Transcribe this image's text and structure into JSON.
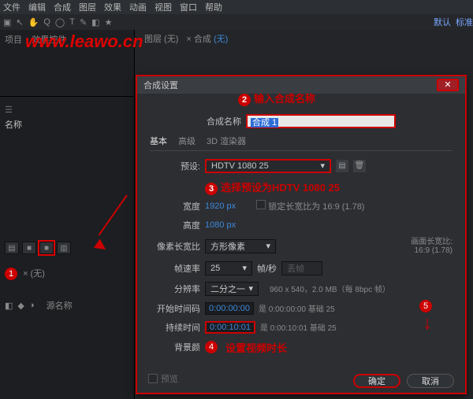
{
  "menubar": [
    "文件",
    "编辑",
    "合成",
    "图层",
    "效果",
    "动画",
    "视图",
    "窗口",
    "帮助"
  ],
  "toolrow": {
    "workspace_default": "默认",
    "workspace_std": "标准"
  },
  "watermark": "www.leawo.cn",
  "preview": {
    "tab1": "图层  (无)",
    "tab2_prefix": "×  合成",
    "tab2_none": "(无)"
  },
  "left": {
    "proj_tab": "项目",
    "fx_tab": "效果控件",
    "name_col": "名称",
    "tl_tab1": "×  (无)",
    "src_col": "源名称",
    "icons": [
      "▤",
      "■",
      "■",
      "▥"
    ]
  },
  "dialog": {
    "title": "合成设置",
    "name_label": "合成名称",
    "name_value": "合成 1",
    "tabs": [
      "基本",
      "高级",
      "3D 渲染器"
    ],
    "preset_label": "预设:",
    "preset_value": "HDTV 1080 25",
    "width_label": "宽度",
    "width_value": "1920 px",
    "lock_label": "锁定长宽比为 16:9 (1.78)",
    "height_label": "高度",
    "height_value": "1080 px",
    "pixel_label": "像素长宽比",
    "pixel_value": "方形像素",
    "frame_aspect_label": "画面长宽比:",
    "frame_aspect_value": "16:9 (1.78)",
    "rate_label": "帧速率",
    "rate_value": "25",
    "rate_unit": "帧/秒",
    "rate_drop": "丢帧",
    "res_label": "分辨率",
    "res_value": "二分之一",
    "res_hint": "960 x 540，2.0 MB（每 8bpc 帧）",
    "start_label": "开始时间码",
    "start_value": "0:00:00:00",
    "start_hint": "是 0:00:00:00  基础 25",
    "dur_label": "持续时间",
    "dur_value": "0:00:10:01",
    "dur_hint": "是 0:00:10:01  基础 25",
    "bg_label": "背景颜",
    "preview_chk": "预览",
    "ok": "确定",
    "cancel": "取消"
  },
  "anno": {
    "n1": "1",
    "n2": "2",
    "t2": "输入合成名称",
    "n3": "3",
    "t3": "选择预设为HDTV 1080 25",
    "n4": "4",
    "t4": "设置视频时长",
    "n5": "5"
  }
}
